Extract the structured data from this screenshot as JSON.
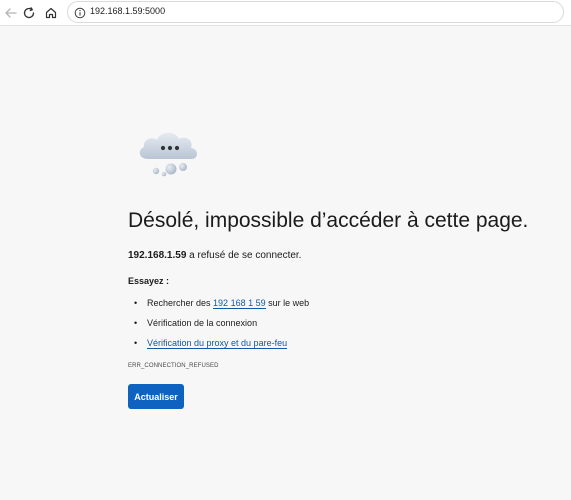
{
  "browser": {
    "url": "192.168.1.59:5000",
    "icons": {
      "back": "back-arrow-icon",
      "reload": "reload-icon",
      "home": "home-icon",
      "site_info": "info-icon"
    }
  },
  "error_page": {
    "illustration": "cloud-icon",
    "heading": "Désolé, impossible d’accéder à cette page.",
    "host": "192.168.1.59",
    "refused_text": " a refusé de se connecter.",
    "try_label": "Essayez :",
    "suggestions": [
      {
        "prefix": "Rechercher des ",
        "link": "192 168 1 59",
        "suffix": " sur le web"
      },
      {
        "text": "Vérification de la connexion"
      },
      {
        "link": "Vérification du proxy et du pare-feu"
      }
    ],
    "error_code": "ERR_CONNECTION_REFUSED",
    "reload_label": "Actualiser"
  },
  "colors": {
    "page_background": "#f7f7f7",
    "link": "#0f5aa6",
    "button": "#0f63c0"
  }
}
